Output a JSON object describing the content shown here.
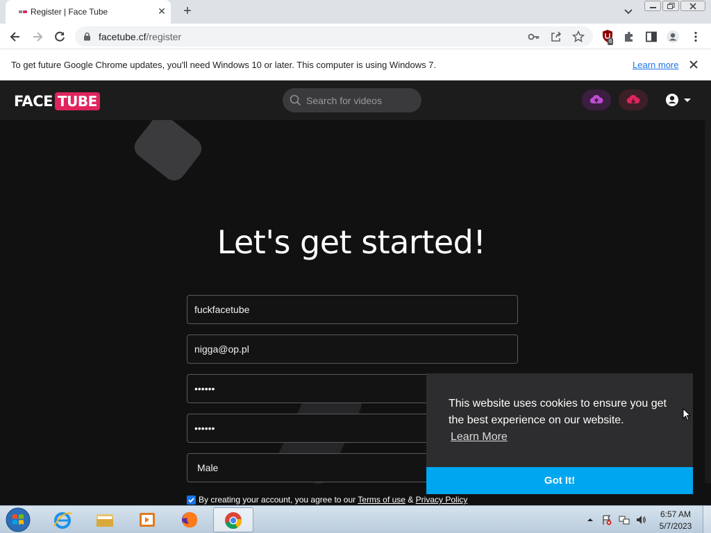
{
  "browser": {
    "tab_title": "Register | Face Tube",
    "url_host": "facetube.cf",
    "url_path": "/register",
    "extension_badge": "6",
    "infobar_text": "To get future Google Chrome updates, you'll need Windows 10 or later. This computer is using Windows 7.",
    "infobar_link": "Learn more"
  },
  "site": {
    "logo_face": "FACE",
    "logo_tube": "TUBE",
    "search_placeholder": "Search for videos",
    "heading": "Let's get started!",
    "form": {
      "username": "fuckfacetube",
      "email": "nigga@op.pl",
      "password": "••••••",
      "confirm_password": "••••••",
      "gender": "Male"
    },
    "terms": {
      "prefix": "By creating your account, you agree to our",
      "terms_link": "Terms of use",
      "amp": "&",
      "privacy_link": "Privacy Policy"
    },
    "colors": {
      "upload_bg": "#3a1f3e",
      "download_bg": "#3d1f28",
      "accent_pink": "#e0245e",
      "cookie_button": "#00a6f0"
    }
  },
  "cookie_banner": {
    "message": "This website uses cookies to ensure you get the best experience on our website.",
    "learn_more": "Learn More",
    "button": "Got It!"
  },
  "taskbar": {
    "time": "6:57 AM",
    "date": "5/7/2023",
    "apps": [
      "internet-explorer",
      "file-explorer",
      "media-player",
      "firefox",
      "chrome"
    ]
  }
}
